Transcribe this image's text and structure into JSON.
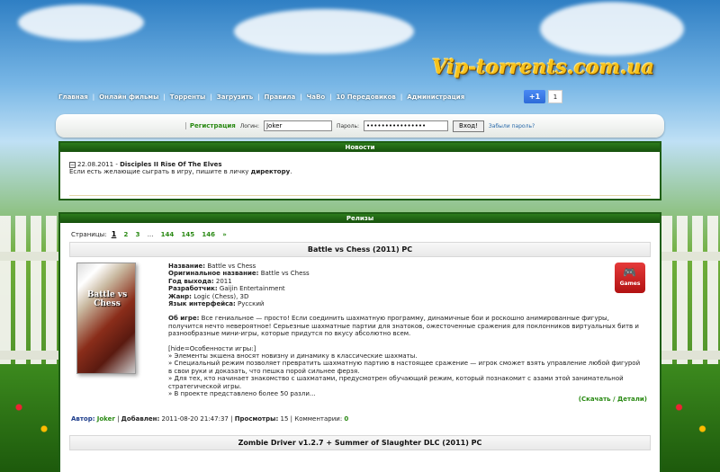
{
  "site": {
    "logo": "Vip-torrents.com.ua"
  },
  "nav": [
    "Главная",
    "Онлайн фильмы",
    "Торренты",
    "Загрузить",
    "Правила",
    "ЧаВо",
    "10 Передовиков",
    "Администрация"
  ],
  "gplus": {
    "label": "+1",
    "count": "1"
  },
  "login": {
    "register": "Регистрация",
    "login_label": "Логин:",
    "login_value": "Joker",
    "password_label": "Пароль:",
    "password_value": "••••••••••••••••",
    "submit": "Вход!",
    "forgot": "Забыли пароль?"
  },
  "news": {
    "header": "Новости",
    "date": "22.08.2011",
    "title": "Disciples II Rise Of The Elves",
    "text_before": "Если есть желающие сыграть в игру, пишите в личку ",
    "text_link": "директору",
    "text_after": "."
  },
  "releases": {
    "header": "Релизы",
    "pages_label": "Страницы:",
    "current_page": "1",
    "pages": [
      "2",
      "3",
      "...",
      "144",
      "145",
      "146",
      "»"
    ],
    "item": {
      "title": "Battle vs Chess (2011) PC",
      "cover_text": "Battle vs Chess",
      "fields": [
        {
          "label": "Название:",
          "value": "Battle vs Chess"
        },
        {
          "label": "Оригинальное название:",
          "value": "Battle vs Chess"
        },
        {
          "label": "Год выхода:",
          "value": "2011"
        },
        {
          "label": "Разработчик:",
          "value": "Gaijin Entertainment"
        },
        {
          "label": "Жанр:",
          "value": "Logic (Chess), 3D"
        },
        {
          "label": "Язык интерфейса:",
          "value": "Русский"
        }
      ],
      "about_label": "Об игре:",
      "about": "Все гениальное — просто! Если соединить шахматную программу, динамичные бои и роскошно анимированные фигуры, получится нечто невероятное! Серьезные шахматные партии для знатоков, ожесточенные сражения для поклонников виртуальных битв и разнообразные мини-игры, которые придутся по вкусу абсолютно всем.",
      "features_head": "[hide=Особенности игры:]",
      "features": [
        "» Элементы экшена вносят новизну и динамику в классические шахматы.",
        "» Специальный режим позволяет превратить шахматную партию в настоящее сражение — игрок сможет взять управление любой фигурой в свои руки и доказать, что пешка порой сильнее ферзя.",
        "» Для тех, кто начинает знакомство с шахматами, предусмотрен обучающий режим, который познакомит с азами этой занимательной стратегической игры.",
        "» В проекте представлено более 50 разли..."
      ],
      "badge": "Games",
      "more": "(Скачать / Детали)",
      "meta": {
        "author_label": "Автор:",
        "author": "Joker",
        "added_label": "Добавлен:",
        "added": "2011-08-20 21:47:37",
        "views_label": "Просмотры:",
        "views": "15",
        "comments_label": "Комментарии:",
        "comments": "0"
      }
    },
    "next_title": "Zombie Driver v1.2.7 + Summer of Slaughter DLC (2011) PC"
  }
}
